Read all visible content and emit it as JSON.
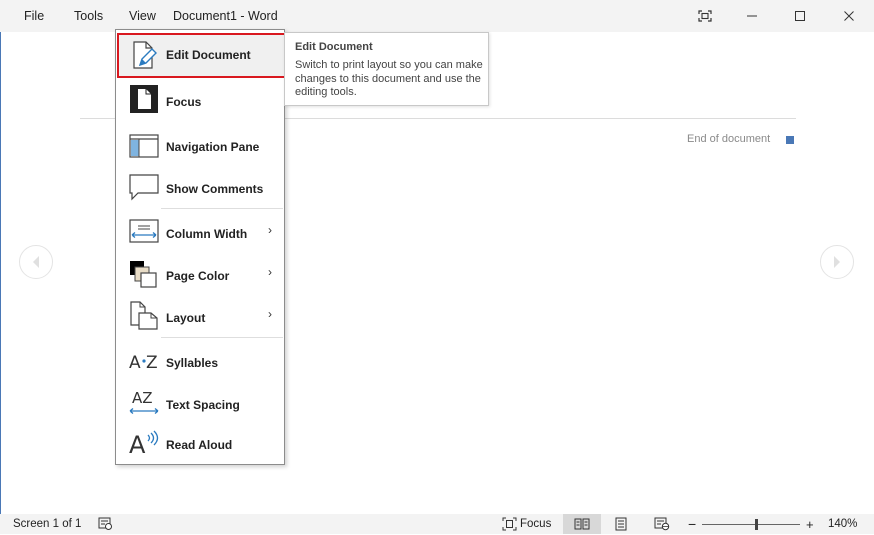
{
  "titlebar": {
    "menu": [
      "File",
      "Tools",
      "View"
    ],
    "document_title": "Document1  -  Word"
  },
  "document": {
    "end_of_document": "End of document"
  },
  "view_menu": {
    "items": [
      {
        "label": "Edit Document",
        "icon": "edit-document-icon"
      },
      {
        "label": "Focus",
        "icon": "focus-icon"
      },
      {
        "label": "Navigation Pane",
        "icon": "navigation-pane-icon"
      },
      {
        "label": "Show Comments",
        "icon": "comments-icon"
      },
      {
        "label": "Column Width",
        "icon": "column-width-icon",
        "submenu": true
      },
      {
        "label": "Page Color",
        "icon": "page-color-icon",
        "submenu": true
      },
      {
        "label": "Layout",
        "icon": "layout-icon",
        "submenu": true
      },
      {
        "label": "Syllables",
        "icon": "syllables-icon"
      },
      {
        "label": "Text Spacing",
        "icon": "text-spacing-icon"
      },
      {
        "label": "Read Aloud",
        "icon": "read-aloud-icon"
      }
    ]
  },
  "tooltip": {
    "title": "Edit Document",
    "body": "Switch to print layout so you can make changes to this document and use the editing tools."
  },
  "statusbar": {
    "screen": "Screen 1 of 1",
    "focus": "Focus",
    "zoom_minus": "−",
    "zoom_plus": "+",
    "zoom_level": "140%",
    "zoom_value": 140
  },
  "colors": {
    "highlight_border": "#d9181f",
    "accent": "#4a78b6"
  }
}
